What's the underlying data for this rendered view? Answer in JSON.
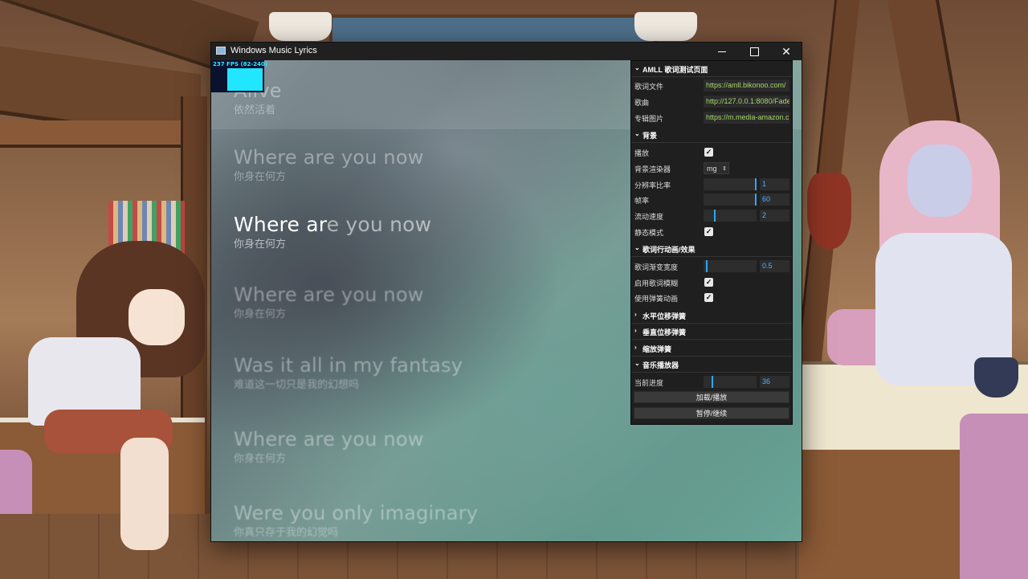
{
  "window": {
    "title": "Windows Music Lyrics"
  },
  "fps_meter": {
    "label": "237 FPS (82-240)"
  },
  "lyrics": [
    {
      "en": "Alive",
      "zh": "依然活着"
    },
    {
      "en": "Where are you now",
      "zh": "你身在何方"
    },
    {
      "en_sung": "Where ar",
      "en_rest": "e you now",
      "zh": "你身在何方",
      "active": true
    },
    {
      "en": "Where are you now",
      "zh": "你身在何方"
    },
    {
      "en": "Was it all in my fantasy",
      "zh": "难道这一切只是我的幻想吗"
    },
    {
      "en": "Where are you now",
      "zh": "你身在何方"
    },
    {
      "en": "Were you only imaginary",
      "zh": "你真只存于我的幻觉吗"
    }
  ],
  "panel": {
    "sections": {
      "test_page": "AMLL 歌词测试页面",
      "background": "背景",
      "line_anim": "歌词行动画/效果",
      "h_spring": "水平位移弹簧",
      "v_spring": "垂直位移弹簧",
      "scale_spring": "缩放弹簧",
      "player": "音乐播放器"
    },
    "fields": {
      "lyric_file": {
        "label": "歌词文件",
        "value": "https://amll.bikonoo.com/"
      },
      "song": {
        "label": "歌曲",
        "value": "http://127.0.0.1:8080/Fade"
      },
      "album_art": {
        "label": "专辑图片",
        "value": "https://m.media-amazon.c"
      },
      "play": {
        "label": "播放",
        "checked": true
      },
      "renderer": {
        "label": "背景渲染器",
        "value": "mg"
      },
      "resolution": {
        "label": "分辨率比率",
        "value": "1",
        "fraction": 1.0
      },
      "fps": {
        "label": "帧率",
        "value": "60",
        "fraction": 1.0
      },
      "flow_speed": {
        "label": "流动速度",
        "value": "2",
        "fraction": 0.2
      },
      "static_mode": {
        "label": "静态模式",
        "checked": true
      },
      "gradient_width": {
        "label": "歌词渐变宽度",
        "value": "0.5",
        "fraction": 0.05
      },
      "blur": {
        "label": "启用歌词模糊",
        "checked": true
      },
      "spring": {
        "label": "使用弹簧动画",
        "checked": true
      },
      "progress": {
        "label": "当前进度",
        "value": "36",
        "fraction": 0.16
      }
    },
    "buttons": {
      "load_play": "加载/播放",
      "pause_resume": "暂停/继续"
    },
    "check_glyph": "✓",
    "chevron_down": "⌄",
    "chevron_right": "›"
  },
  "icons": {
    "close": "✕"
  }
}
